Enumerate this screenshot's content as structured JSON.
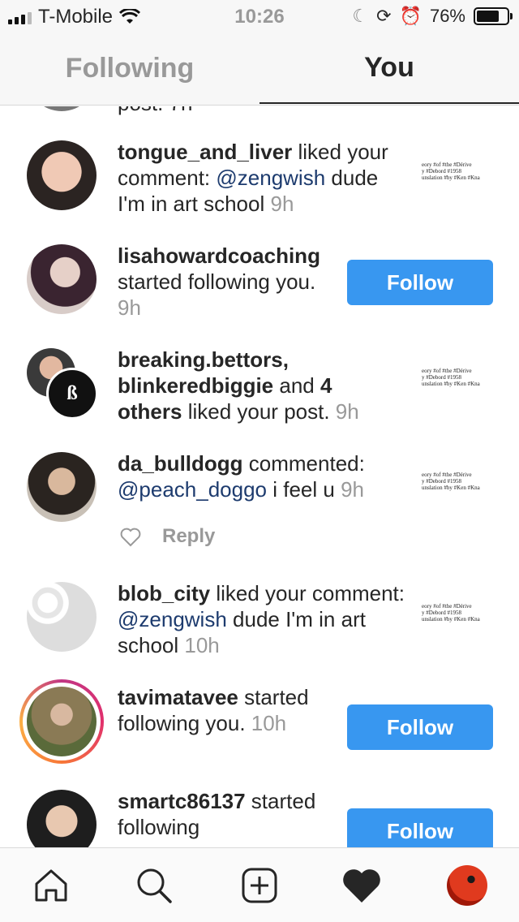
{
  "status_bar": {
    "carrier": "T-Mobile",
    "time": "10:26",
    "battery": "76%",
    "battery_level": 0.76
  },
  "tabs": [
    {
      "label": "Following",
      "active": false
    },
    {
      "label": "You",
      "active": true
    }
  ],
  "partial_top_text": "post. 7h",
  "thumb_text": [
    "eory #of #the #Dérive",
    "y #Debord #1958",
    "unslation #by #Ken #Kna"
  ],
  "notifications": {
    "n1": {
      "user": "tongue_and_liver",
      "action": " liked your comment: ",
      "mention": "@zengwish",
      "rest": " dude I'm in art school ",
      "time": "9h"
    },
    "n2": {
      "user": "lisahowardcoaching",
      "action": " started following you. ",
      "time": "9h",
      "button": "Follow"
    },
    "n3": {
      "users": "breaking.bettors, blinkeredbiggie",
      "and": " and ",
      "others": "4 others",
      "action": " liked your post. ",
      "time": "9h"
    },
    "n4": {
      "user": "da_bulldogg",
      "action": " commented: ",
      "mention": "@peach_doggo",
      "rest": " i feel u ",
      "time": "9h",
      "reply": "Reply"
    },
    "n5": {
      "user": "blob_city",
      "action": " liked your comment: ",
      "mention": "@zengwish",
      "rest": " dude I'm in art school ",
      "time": "10h"
    },
    "n6": {
      "user": "tavimatavee",
      "action": " started following you. ",
      "time": "10h",
      "button": "Follow"
    },
    "n7": {
      "user": "smartc86137",
      "action": " started following",
      "button": "Follow"
    }
  },
  "nav": [
    "home-icon",
    "search-icon",
    "add-post-icon",
    "heart-icon",
    "profile-avatar"
  ],
  "colors": {
    "follow_button": "#3897f0",
    "mention": "#1d3b6e",
    "muted": "#999999"
  }
}
